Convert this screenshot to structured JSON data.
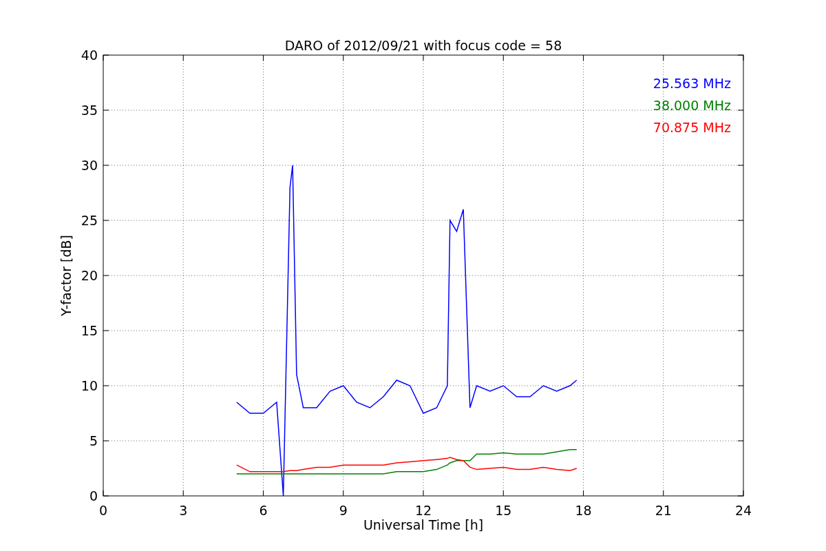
{
  "figure": {
    "chart_data": {
      "type": "line",
      "title": "DARO of 2012/09/21 with focus code = 58",
      "xlabel": "Universal Time [h]",
      "ylabel": "Y-factor [dB]",
      "x": [
        5,
        5.5,
        6,
        6.5,
        6.75,
        7,
        7.1,
        7.25,
        7.5,
        8,
        8.5,
        9,
        9.5,
        10,
        10.5,
        11,
        11.5,
        12,
        12.5,
        12.9,
        13,
        13.25,
        13.5,
        13.75,
        14,
        14.5,
        15,
        15.5,
        16,
        16.5,
        17,
        17.5,
        17.75
      ],
      "series": [
        {
          "name": "25.563 MHz",
          "color": "#0000ff",
          "values": [
            8.5,
            7.5,
            7.5,
            8.5,
            0,
            28,
            30,
            11,
            8,
            8,
            9.5,
            10,
            8.5,
            8,
            9,
            10.5,
            10,
            7.5,
            8,
            10,
            25,
            24,
            26,
            8,
            10,
            9.5,
            10,
            9,
            9,
            10,
            9.5,
            10,
            10.5
          ]
        },
        {
          "name": "38.000 MHz",
          "color": "#008000",
          "values": [
            2,
            2,
            2,
            2,
            2,
            2,
            2,
            2,
            2,
            2,
            2,
            2,
            2,
            2,
            2,
            2.2,
            2.2,
            2.2,
            2.4,
            2.8,
            3,
            3.2,
            3.2,
            3.2,
            3.8,
            3.8,
            3.9,
            3.8,
            3.8,
            3.8,
            4,
            4.2,
            4.2
          ]
        },
        {
          "name": "70.875 MHz",
          "color": "#ff0000",
          "values": [
            2.8,
            2.2,
            2.2,
            2.2,
            2.2,
            2.3,
            2.3,
            2.3,
            2.4,
            2.6,
            2.6,
            2.8,
            2.8,
            2.8,
            2.8,
            3,
            3.1,
            3.2,
            3.3,
            3.4,
            3.5,
            3.3,
            3.2,
            2.6,
            2.4,
            2.5,
            2.6,
            2.4,
            2.4,
            2.6,
            2.4,
            2.3,
            2.5
          ]
        }
      ],
      "grid": true,
      "xlim": [
        0,
        24
      ],
      "ylim": [
        0,
        40
      ],
      "xticks": [
        0,
        3,
        6,
        9,
        12,
        15,
        18,
        21,
        24
      ],
      "yticks": [
        0,
        5,
        10,
        15,
        20,
        25,
        30,
        35,
        40
      ]
    }
  }
}
